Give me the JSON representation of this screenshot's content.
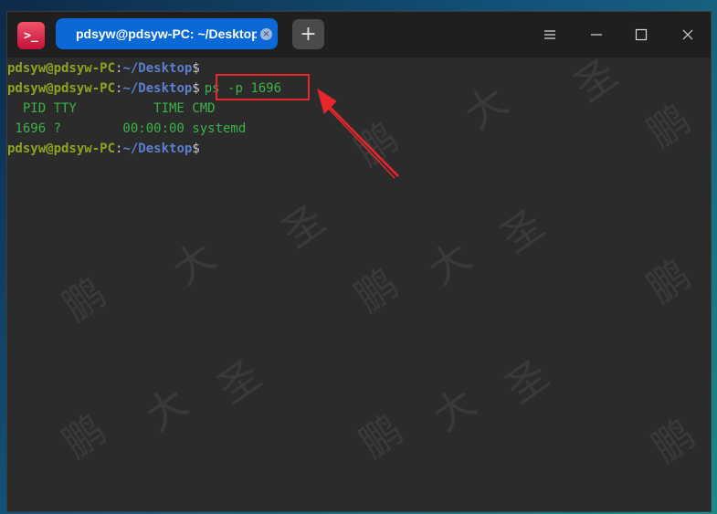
{
  "app": {
    "icon_glyph": ">_",
    "tab_title": "pdsyw@pdsyw-PC: ~/Desktop",
    "tab_close_glyph": "×",
    "new_tab_glyph": "+"
  },
  "window_controls": {
    "menu_icon": "hamburger-menu-icon",
    "minimize_icon": "minimize-icon",
    "maximize_icon": "maximize-icon",
    "close_icon": "close-icon"
  },
  "terminal": {
    "lines": [
      {
        "user": "pdsyw@pdsyw-PC",
        "colon": ":",
        "path": "~/Desktop",
        "dollar": "$",
        "command": ""
      },
      {
        "user": "pdsyw@pdsyw-PC",
        "colon": ":",
        "path": "~/Desktop",
        "dollar": "$",
        "command": "ps -p 1696"
      },
      {
        "output": "  PID TTY          TIME CMD"
      },
      {
        "output": " 1696 ?        00:00:00 systemd"
      },
      {
        "user": "pdsyw@pdsyw-PC",
        "colon": ":",
        "path": "~/Desktop",
        "dollar": "$",
        "command": ""
      }
    ]
  },
  "annotation": {
    "highlight_color": "#e8262b",
    "arrow_color": "#e8262b"
  },
  "watermark": {
    "chars": [
      "鹏",
      "大",
      "圣"
    ]
  },
  "colors": {
    "tab_active": "#0a69d6",
    "user": "#8ea421",
    "path": "#5b7fce",
    "output": "#3bb24a",
    "background": "#2b2b2b"
  }
}
